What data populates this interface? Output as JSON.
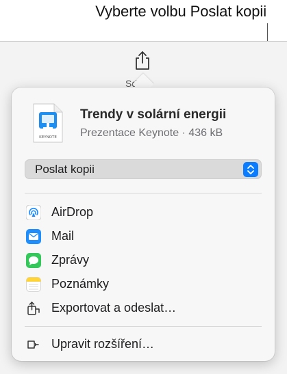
{
  "callout": {
    "text": "Vyberte volbu Poslat kopii"
  },
  "toolbar": {
    "share_label": "Sdílet"
  },
  "document": {
    "title": "Trendy v solární energii",
    "subtitle": "Prezentace Keynote · 436 kB",
    "icon_caption": "KEYNOTE"
  },
  "share_mode": {
    "selected": "Poslat kopii"
  },
  "share_options": [
    {
      "label": "AirDrop",
      "icon": "airdrop-icon"
    },
    {
      "label": "Mail",
      "icon": "mail-icon"
    },
    {
      "label": "Zprávy",
      "icon": "messages-icon"
    },
    {
      "label": "Poznámky",
      "icon": "notes-icon"
    },
    {
      "label": "Exportovat a odeslat…",
      "icon": "export-icon"
    }
  ],
  "footer": {
    "edit_extensions_label": "Upravit rozšíření…"
  },
  "colors": {
    "accent": "#0a7cff",
    "keynote_blue": "#1d8ff2",
    "messages_green": "#34c759",
    "notes_yellow": "#ffd43b"
  }
}
